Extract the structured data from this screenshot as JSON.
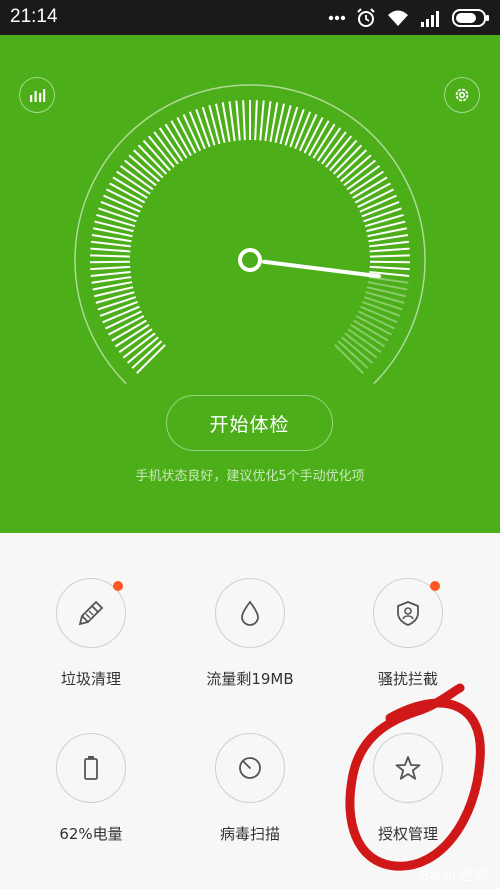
{
  "status_bar": {
    "time": "21:14",
    "icons": [
      "more-dots-icon",
      "alarm-icon",
      "wifi-icon",
      "signal-icon",
      "battery-icon"
    ]
  },
  "header": {
    "left_icon": "bar-chart-icon",
    "right_icon": "gear-icon"
  },
  "gauge": {
    "score_fraction": 0.86
  },
  "main": {
    "start_button_label": "开始体检",
    "hint_text": "手机状态良好，建议优化5个手动优化项"
  },
  "tools": [
    {
      "label": "垃圾清理",
      "icon": "broom-icon",
      "badge": true
    },
    {
      "label": "流量剩19MB",
      "icon": "water-drop-icon",
      "badge": false
    },
    {
      "label": "骚扰拦截",
      "icon": "shield-user-icon",
      "badge": true
    },
    {
      "label": "62%电量",
      "icon": "battery-icon",
      "badge": false
    },
    {
      "label": "病毒扫描",
      "icon": "scan-icon",
      "badge": false
    },
    {
      "label": "授权管理",
      "icon": "star-icon",
      "badge": false
    }
  ],
  "watermark": "Baidu 经验",
  "colors": {
    "brand_green": "#4caf19",
    "badge_orange": "#ff5722",
    "annotation_red": "#d01818"
  }
}
